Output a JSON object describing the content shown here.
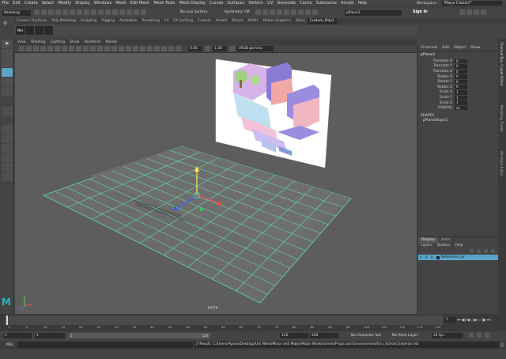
{
  "menubar": {
    "items": [
      "File",
      "Edit",
      "Create",
      "Select",
      "Modify",
      "Display",
      "Windows",
      "Mesh",
      "Edit Mesh",
      "Mesh Tools",
      "Mesh Display",
      "Curves",
      "Surfaces",
      "Deform",
      "UV",
      "Generate",
      "Cache",
      "Substance",
      "Arnold",
      "Help"
    ],
    "workspace_label": "Workspace :",
    "workspace_value": "Maya Classic*"
  },
  "statusline": {
    "mode_menu": "Modeling",
    "live_surface": "No Live Surface",
    "symmetry": "Symmetry: Off",
    "object_name": "pPlane1",
    "sign_in": "Sign In"
  },
  "shelf_tabs": [
    "Curves / Surfaces",
    "Poly Modeling",
    "Sculpting",
    "Rigging",
    "Animation",
    "Rendering",
    "FX",
    "FX Caching",
    "Custom",
    "Arnold",
    "Bifrost",
    "MASH",
    "Motion Graphics",
    "XGen",
    "Custom_Poly1"
  ],
  "shelf_active": "Custom_Poly1",
  "viewport": {
    "menu": [
      "View",
      "Shading",
      "Lighting",
      "Show",
      "Renderer",
      "Panels"
    ],
    "field_a": "0.00",
    "field_b": "1.00",
    "color_space": "sRGB gamma",
    "camera_label": "persp"
  },
  "channel_box": {
    "menu": [
      "Channels",
      "Edit",
      "Object",
      "Show"
    ],
    "object": "pPlane1",
    "attributes": [
      {
        "label": "Translate X",
        "value": "0"
      },
      {
        "label": "Translate Y",
        "value": "0"
      },
      {
        "label": "Translate Z",
        "value": "0"
      },
      {
        "label": "Rotate X",
        "value": "0"
      },
      {
        "label": "Rotate Y",
        "value": "0"
      },
      {
        "label": "Rotate Z",
        "value": "0"
      },
      {
        "label": "Scale X",
        "value": "1"
      },
      {
        "label": "Scale Y",
        "value": "1"
      },
      {
        "label": "Scale Z",
        "value": "1"
      },
      {
        "label": "Visibility",
        "value": "on"
      }
    ],
    "shapes_header": "SHAPES",
    "shape_name": "pPlaneShape1"
  },
  "layer_editor": {
    "tabs": [
      "Display",
      "Anim"
    ],
    "menu": [
      "Layers",
      "Options",
      "Help"
    ],
    "layer_name": "Reference_lyr",
    "layer_flags": [
      "V",
      "P",
      "R"
    ]
  },
  "side_tabs": [
    "Channel Box / Layer Editor",
    "Modeling Toolkit",
    "Attribute Editor"
  ],
  "time_slider": {
    "ticks": [
      "1",
      "5",
      "10",
      "15",
      "20",
      "25",
      "30",
      "35",
      "40",
      "45",
      "50",
      "55",
      "60",
      "65",
      "70",
      "75",
      "80",
      "85",
      "90",
      "95",
      "100",
      "105",
      "110",
      "115",
      "120"
    ],
    "current_frame": "1"
  },
  "range_bar": {
    "start": "1",
    "start_inner": "1",
    "range_start_label": "1",
    "range_end_label": "120",
    "end_inner": "120",
    "end": "200",
    "character_set": "No Character Set",
    "anim_layer": "No Anim Layer",
    "fps": "24 fps"
  },
  "command_line": {
    "label": "MEL",
    "result": "// Result: C:/Users/Ayaan/Desktop/Uni Work/Minor and Major/Major Work/scenes/Props and Environment/Env_School_Exterior.mb"
  },
  "colors": {
    "grid_line": "#5fdca8",
    "plane_fill": "#6b6b6b",
    "viewport_bg": "#5d5d5d",
    "selection": "#5aa5c8"
  }
}
